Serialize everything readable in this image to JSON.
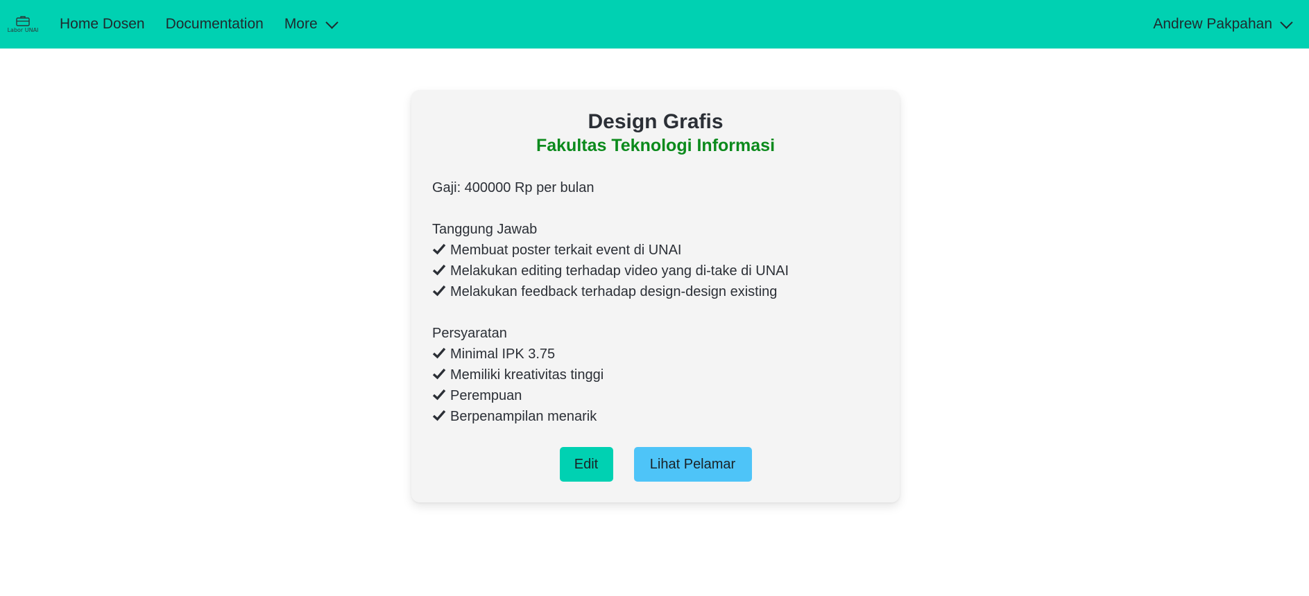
{
  "navbar": {
    "brand_text": "Labor UNAI",
    "items": [
      {
        "label": "Home Dosen"
      },
      {
        "label": "Documentation"
      },
      {
        "label": "More"
      }
    ],
    "user_name": "Andrew Pakpahan",
    "background": "#00d1b2"
  },
  "card": {
    "title": "Design Grafis",
    "subtitle": "Fakultas Teknologi Informasi",
    "salary": "Gaji: 400000 Rp per bulan",
    "responsibilities_title": "Tanggung Jawab",
    "responsibilities": [
      "Membuat poster terkait event di UNAI",
      "Melakukan editing terhadap video yang di-take di UNAI",
      "Melakukan feedback terhadap design-design existing"
    ],
    "requirements_title": "Persyaratan",
    "requirements": [
      "Minimal IPK 3.75",
      "Memiliki kreativitas tinggi",
      "Perempuan",
      "Berpenampilan menarik"
    ],
    "buttons": {
      "edit_label": "Edit",
      "view_applicants_label": "Lihat Pelamar"
    },
    "colors": {
      "subtitle": "#0b8a1c",
      "edit_button": "#00d1b2",
      "view_button": "#4ec4f8"
    }
  },
  "icons": {
    "brand": "briefcase-icon",
    "dropdown": "chevron-down-icon",
    "list_marker": "check-icon"
  }
}
